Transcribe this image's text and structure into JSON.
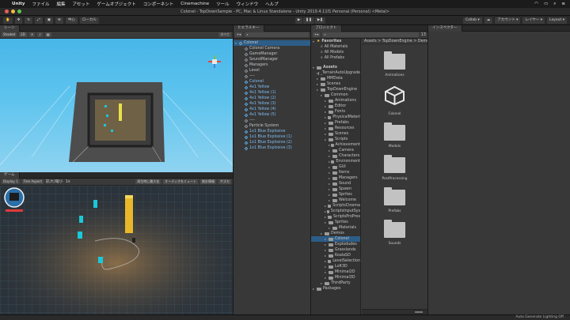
{
  "menubar": {
    "app_name": "Unity",
    "items": [
      "ファイル",
      "編集",
      "アセット",
      "ゲームオブジェクト",
      "コンポーネント",
      "Cinemachine",
      "ツール",
      "ウィンドウ",
      "ヘルプ"
    ]
  },
  "window": {
    "title": "Colonel - TopDownSample - PC, Mac & Linux Standalone - Unity 2019.4.11f1 Personal (Personal) <Metal>"
  },
  "toolbar": {
    "pivot": "中心",
    "local": "ローカル",
    "collab": "Collab ▾",
    "account": "アカウント ▾",
    "layers": "レイヤー ▾",
    "layout": "Layout ▾"
  },
  "scene": {
    "tab": "シーン",
    "shading": "Shaded",
    "mode2d": "2D",
    "all": "すべて"
  },
  "game": {
    "tab": "ゲーム",
    "display": "Display 1",
    "aspect": "Free Aspect",
    "scale_label": "拡大/縮小",
    "scale_value": "1x",
    "maximize": "再生時に最大化",
    "mute": "オーディオをミュート",
    "stats": "統計情報",
    "gizmos": "ギズモ"
  },
  "hierarchy": {
    "tab": "ヒエラルキー",
    "items": [
      {
        "label": "Colonel",
        "type": "root",
        "indent": 0,
        "selected": true
      },
      {
        "label": "Colonel Camera",
        "type": "cube",
        "indent": 1
      },
      {
        "label": "GameManager",
        "type": "cube",
        "indent": 1
      },
      {
        "label": "SoundManager",
        "type": "cube",
        "indent": 1
      },
      {
        "label": "Managers",
        "type": "cube",
        "indent": 1
      },
      {
        "label": "Level",
        "type": "cube",
        "indent": 1
      },
      {
        "label": "----",
        "type": "cube",
        "indent": 1
      },
      {
        "label": "Colonel",
        "type": "blue",
        "indent": 1
      },
      {
        "label": "4x1 Yellow",
        "type": "blue",
        "indent": 1
      },
      {
        "label": "4x1 Yellow (1)",
        "type": "blue",
        "indent": 1
      },
      {
        "label": "4x1 Yellow (2)",
        "type": "blue",
        "indent": 1
      },
      {
        "label": "4x1 Yellow (3)",
        "type": "blue",
        "indent": 1
      },
      {
        "label": "4x1 Yellow (4)",
        "type": "blue",
        "indent": 1
      },
      {
        "label": "4x1 Yellow (5)",
        "type": "blue",
        "indent": 1
      },
      {
        "label": "----",
        "type": "cube",
        "indent": 1
      },
      {
        "label": "Particle System",
        "type": "cube",
        "indent": 1
      },
      {
        "label": "1x1 Blue Explosive",
        "type": "blue",
        "indent": 1
      },
      {
        "label": "1x1 Blue Explosive (1)",
        "type": "blue",
        "indent": 1
      },
      {
        "label": "1x1 Blue Explosive (2)",
        "type": "blue",
        "indent": 1
      },
      {
        "label": "1x1 Blue Explosive (3)",
        "type": "blue",
        "indent": 1
      }
    ]
  },
  "project": {
    "tab": "プロジェクト",
    "favorites_label": "Favorites",
    "favorites": [
      "All Materials",
      "All Models",
      "All Prefabs"
    ],
    "assets_label": "Assets",
    "tree": [
      {
        "label": "_TerrainAutoUpgrade",
        "indent": 1
      },
      {
        "label": "MMData",
        "indent": 1
      },
      {
        "label": "Scenes",
        "indent": 1
      },
      {
        "label": "TopDownEngine",
        "indent": 1
      },
      {
        "label": "Common",
        "indent": 2
      },
      {
        "label": "Animations",
        "indent": 3
      },
      {
        "label": "Editor",
        "indent": 3
      },
      {
        "label": "Fonts",
        "indent": 3
      },
      {
        "label": "PhysicalMateri",
        "indent": 3
      },
      {
        "label": "Prefabs",
        "indent": 3
      },
      {
        "label": "Resources",
        "indent": 3
      },
      {
        "label": "Scenes",
        "indent": 3
      },
      {
        "label": "Scripts",
        "indent": 3
      },
      {
        "label": "Achievement",
        "indent": 4
      },
      {
        "label": "Camera",
        "indent": 4
      },
      {
        "label": "Characters",
        "indent": 4
      },
      {
        "label": "Environment",
        "indent": 4
      },
      {
        "label": "GUI",
        "indent": 4
      },
      {
        "label": "Items",
        "indent": 4
      },
      {
        "label": "Managers",
        "indent": 4
      },
      {
        "label": "Sound",
        "indent": 4
      },
      {
        "label": "Spawn",
        "indent": 4
      },
      {
        "label": "Sprites",
        "indent": 4
      },
      {
        "label": "Welcome",
        "indent": 4
      },
      {
        "label": "ScriptsCinema",
        "indent": 3
      },
      {
        "label": "ScriptsInputSys",
        "indent": 3
      },
      {
        "label": "ScriptsProPros",
        "indent": 3
      },
      {
        "label": "Sprites",
        "indent": 3
      },
      {
        "label": "Materials",
        "indent": 4
      },
      {
        "label": "Demos",
        "indent": 2
      },
      {
        "label": "Colonel",
        "indent": 3,
        "selected": true
      },
      {
        "label": "Explodudes",
        "indent": 3
      },
      {
        "label": "Grasslands",
        "indent": 3
      },
      {
        "label": "KoalaSD",
        "indent": 3
      },
      {
        "label": "LevelSelection",
        "indent": 3
      },
      {
        "label": "Loft3D",
        "indent": 3
      },
      {
        "label": "Minimal2D",
        "indent": 3
      },
      {
        "label": "Minimal3D",
        "indent": 3
      },
      {
        "label": "ThirdParty",
        "indent": 2
      },
      {
        "label": "Packages",
        "indent": 0
      }
    ],
    "breadcrumb": "Assets > TopDownEngine > Demos",
    "grid": [
      {
        "label": "Animations",
        "kind": "folder"
      },
      {
        "label": "Colonel",
        "kind": "unity"
      },
      {
        "label": "Models",
        "kind": "folder"
      },
      {
        "label": "PostProcessing",
        "kind": "folder"
      },
      {
        "label": "Prefabs",
        "kind": "folder"
      },
      {
        "label": "Sounds",
        "kind": "folder"
      }
    ],
    "count": "13"
  },
  "inspector": {
    "tab": "インスペクター"
  },
  "status": {
    "text": "Auto Generate Lighting Off"
  },
  "colors": {
    "accent": "#2c5d87",
    "scene_sky": "#5ec4ee",
    "yellow_block": "#e8b82a",
    "cyan_block": "#19c9d8"
  }
}
